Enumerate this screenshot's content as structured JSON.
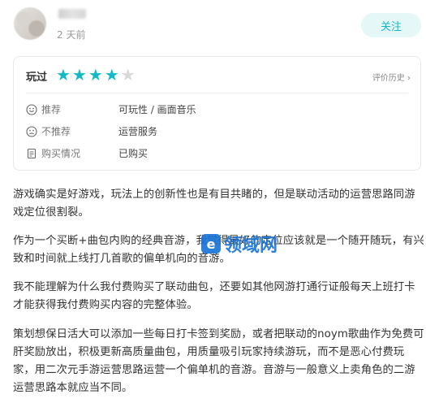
{
  "header": {
    "username": "",
    "time": "2 天前",
    "follow_label": "关注"
  },
  "rating": {
    "played_label": "玩过",
    "stars_filled": 4,
    "stars_total": 5,
    "history_label": "评价历史",
    "history_arrow": "›",
    "accent_color": "#14b9c8"
  },
  "details": [
    {
      "icon": "smile-icon",
      "label": "推荐",
      "value": "可玩性 / 画面音乐"
    },
    {
      "icon": "frown-icon",
      "label": "不推荐",
      "value": "运营服务"
    },
    {
      "icon": "purchase-tag-icon",
      "label": "购买情况",
      "value": "已购买"
    }
  ],
  "paragraphs": [
    "游戏确实是好游戏，玩法上的创新性也是有目共睹的，但是联动活动的运营思路同游戏定位很割裂。",
    "作为一个买断+曲包内购的经典音游，我觉得最好的定位应该就是一个随开随玩，有兴致和时间就上线打几首歌的偏单机向的音游。",
    "我不能理解为什么我付费购买了联动曲包，还要如其他网游打通行证般每天上班打卡才能获得我付费购买内容的完整体验。",
    "策划想保日活大可以添加一些每日打卡签到奖励，或者把联动的noym歌曲作为免费可肝奖励放出，积极更新高质量曲包，用质量吸引玩家持续游玩，而不是恶心付费玩家，用二次元手游运营思路运营一个偏单机的音游。音游与一般意义上卖角色的二游运营思路本就应当不同。"
  ],
  "watermark": {
    "logo_glyph": "e",
    "text": "领域网"
  }
}
